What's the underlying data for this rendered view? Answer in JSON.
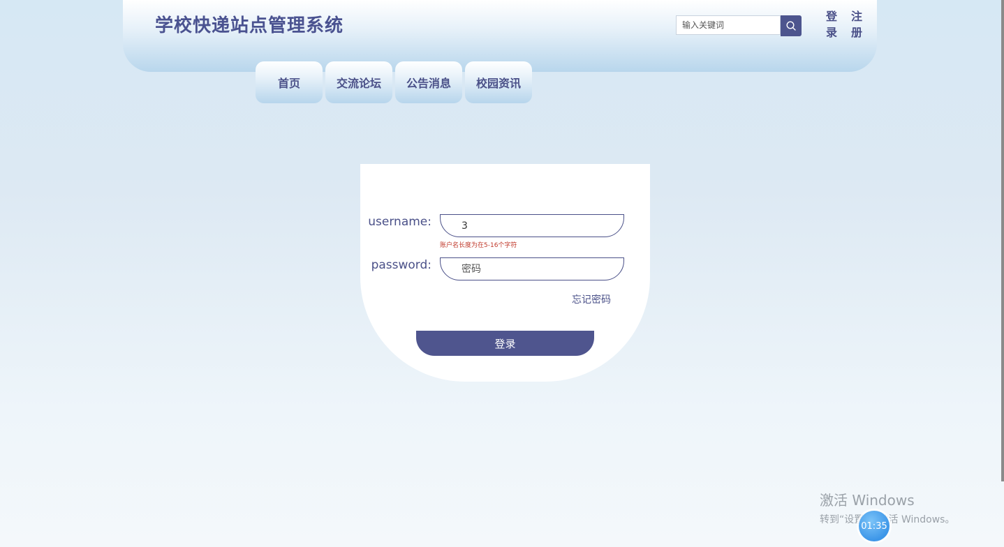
{
  "header": {
    "site_title": "学校快递站点管理系统",
    "search_placeholder": "输入关键词",
    "search_icon": "search-icon",
    "login_link": "登录",
    "register_link": "注册"
  },
  "nav": {
    "items": [
      {
        "label": "首页"
      },
      {
        "label": "交流论坛"
      },
      {
        "label": "公告消息"
      },
      {
        "label": "校园资讯"
      }
    ]
  },
  "login_form": {
    "username_label": "username:",
    "username_value": "3",
    "username_error": "账户名长度为在5-16个字符",
    "password_label": "password:",
    "password_placeholder": "密码",
    "forgot_password": "忘记密码",
    "submit_label": "登录"
  },
  "overlay": {
    "watermark_title": "激活 Windows",
    "watermark_sub": "转到“设置”以激活 Windows。",
    "timer": "01:35"
  },
  "colors": {
    "accent": "#4f558e",
    "error": "#c0392b",
    "card": "#ffffff"
  }
}
